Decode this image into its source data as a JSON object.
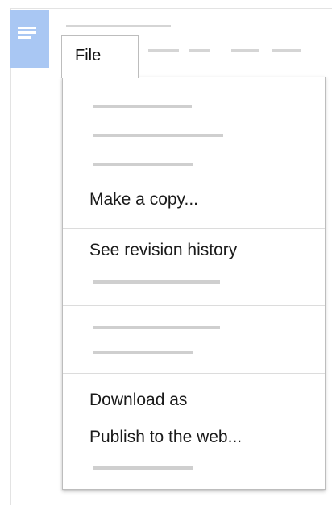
{
  "header": {
    "app_icon": "docs-icon"
  },
  "menu": {
    "tab_label": "File",
    "items": [
      {
        "label": "Make a copy..."
      },
      {
        "label": "See revision history"
      },
      {
        "label": "Download as"
      },
      {
        "label": "Publish to the web..."
      }
    ]
  },
  "colors": {
    "icon_tile": "#a9c7f3",
    "placeholder": "#cfcfcf",
    "menu_border": "#bdbdbd"
  }
}
